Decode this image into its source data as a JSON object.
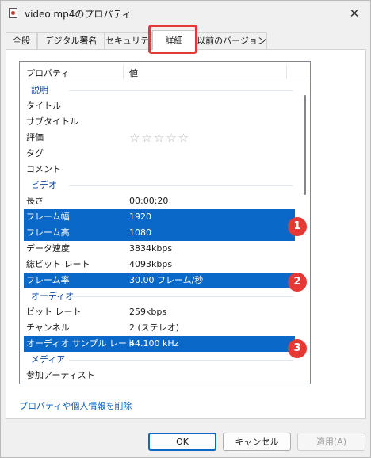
{
  "window": {
    "title": "video.mp4のプロパティ",
    "close_glyph": "✕"
  },
  "tabs": [
    {
      "label": "全般"
    },
    {
      "label": "デジタル署名"
    },
    {
      "label": "セキュリティ"
    },
    {
      "label": "詳細"
    },
    {
      "label": "以前のバージョン"
    }
  ],
  "active_tab": "詳細",
  "table": {
    "header_property": "プロパティ",
    "header_value": "値"
  },
  "rows": [
    {
      "type": "group",
      "name": "説明"
    },
    {
      "type": "row",
      "name": "タイトル",
      "value": ""
    },
    {
      "type": "row",
      "name": "サブタイトル",
      "value": ""
    },
    {
      "type": "rating",
      "name": "評価",
      "value": "☆☆☆☆☆"
    },
    {
      "type": "row",
      "name": "タグ",
      "value": ""
    },
    {
      "type": "row",
      "name": "コメント",
      "value": ""
    },
    {
      "type": "group",
      "name": "ビデオ"
    },
    {
      "type": "row",
      "name": "長さ",
      "value": "00:00:20"
    },
    {
      "type": "row",
      "name": "フレーム幅",
      "value": "1920",
      "selected": true
    },
    {
      "type": "row",
      "name": "フレーム高",
      "value": "1080",
      "selected": true
    },
    {
      "type": "row",
      "name": "データ速度",
      "value": "3834kbps"
    },
    {
      "type": "row",
      "name": "総ビット レート",
      "value": "4093kbps"
    },
    {
      "type": "row",
      "name": "フレーム率",
      "value": "30.00 フレーム/秒",
      "selected": true
    },
    {
      "type": "group",
      "name": "オーディオ"
    },
    {
      "type": "row",
      "name": "ビット レート",
      "value": "259kbps"
    },
    {
      "type": "row",
      "name": "チャンネル",
      "value": "2 (ステレオ)"
    },
    {
      "type": "row",
      "name": "オーディオ サンプル レート",
      "value": "44.100 kHz",
      "selected": true
    },
    {
      "type": "group",
      "name": "メディア"
    },
    {
      "type": "row",
      "name": "参加アーティスト",
      "value": ""
    }
  ],
  "badges": [
    "1",
    "2",
    "3"
  ],
  "remove_link": "プロパティや個人情報を削除",
  "buttons": {
    "ok": "OK",
    "cancel": "キャンセル",
    "apply": "適用(A)"
  },
  "colors": {
    "selection": "#0a68c8",
    "annotation": "#e53935",
    "link": "#0b61c4"
  }
}
